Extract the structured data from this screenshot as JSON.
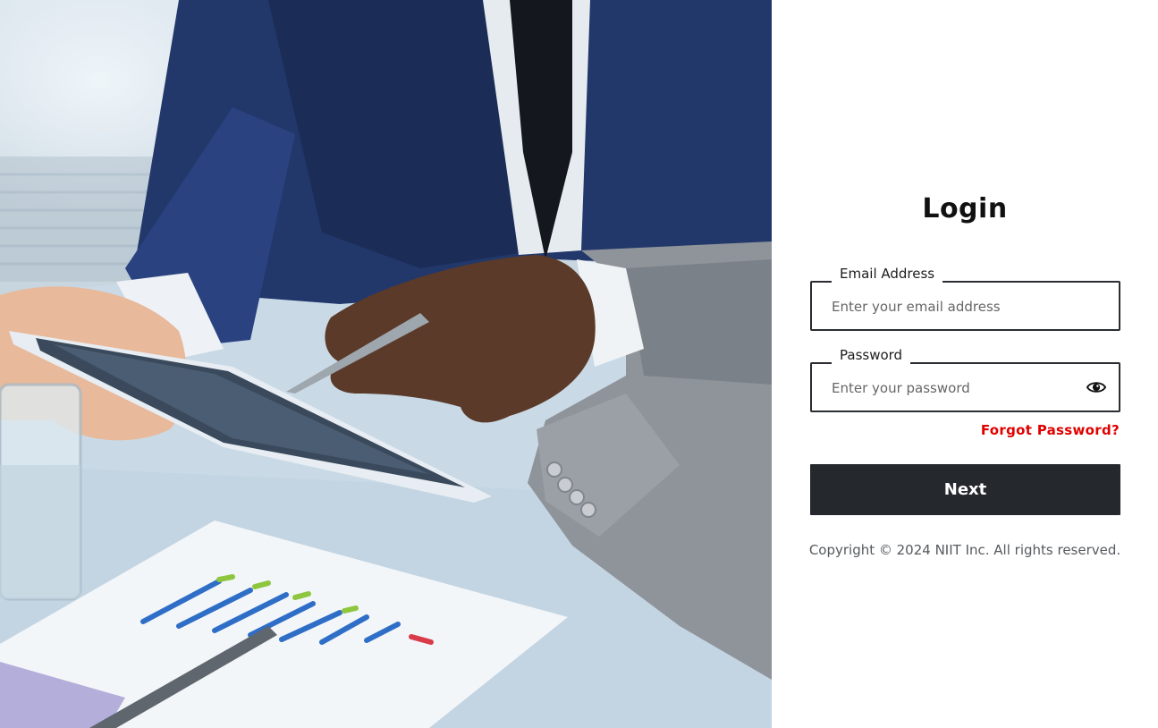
{
  "hero": {
    "image_name": "business-meeting-tablet-photo"
  },
  "login": {
    "title": "Login",
    "email": {
      "label": "Email Address",
      "placeholder": "Enter your email address",
      "value": ""
    },
    "password": {
      "label": "Password",
      "placeholder": "Enter your password",
      "value": "",
      "toggle_icon": "eye-icon"
    },
    "forgot_label": "Forgot Password?",
    "submit_label": "Next"
  },
  "footer": {
    "copyright": "Copyright © 2024 NIIT Inc. All rights reserved."
  },
  "colors": {
    "button_bg": "#25282c",
    "link": "#e10000",
    "border": "#2a2d31"
  }
}
